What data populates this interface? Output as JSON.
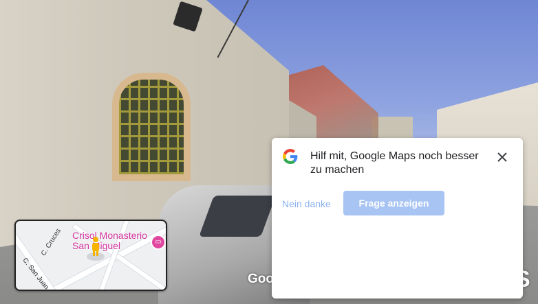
{
  "dialog": {
    "title": "Hilf mit, Google Maps noch besser zu machen",
    "decline_label": "Nein danke",
    "accept_label": "Frage anzeigen",
    "accent_color": "#a8c4f3"
  },
  "minimap": {
    "poi_name": "Crisol Monasterio San Miguel",
    "streets": [
      "C. Cruces",
      "C. San Juan"
    ],
    "poi_color": "#d0309a"
  },
  "watermark": {
    "text": "Goo",
    "right_mark": "S"
  },
  "icons": {
    "logo": "google-g-icon",
    "close": "close-icon",
    "pegman": "pegman-icon",
    "hotel": "hotel-icon"
  }
}
